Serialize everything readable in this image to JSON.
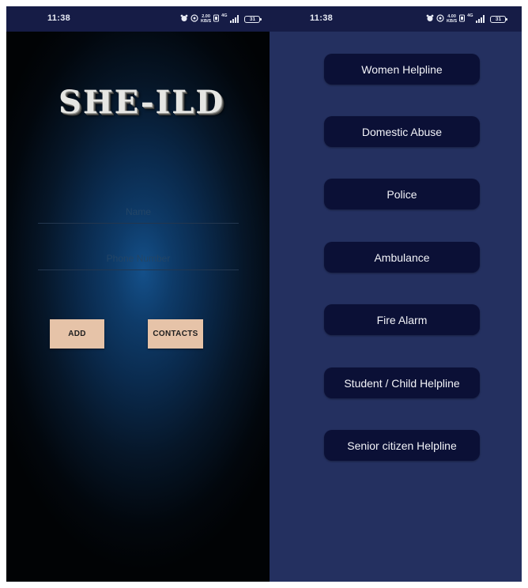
{
  "status_bar_left": {
    "time": "11:38",
    "data_speed_value": "2.00",
    "data_speed_unit": "KB/S",
    "network": "4G",
    "battery": "31"
  },
  "status_bar_right": {
    "time": "11:38",
    "data_speed_value": "4.00",
    "data_speed_unit": "KB/S",
    "network": "4G",
    "battery": "31"
  },
  "register": {
    "title": "SHE-ILD",
    "name_placeholder": "Name",
    "phone_placeholder": "Phone Number",
    "add_label": "ADD",
    "contacts_label": "CONTACTS"
  },
  "helplines": {
    "items": [
      {
        "label": "Women Helpline"
      },
      {
        "label": "Domestic Abuse"
      },
      {
        "label": "Police"
      },
      {
        "label": "Ambulance"
      },
      {
        "label": "Fire Alarm"
      },
      {
        "label": "Student / Child Helpline"
      },
      {
        "label": "Senior citizen Helpline"
      }
    ]
  },
  "colors": {
    "status_bar": "#161c46",
    "left_gradient_center": "#14508a",
    "left_background_edge": "#010305",
    "right_background": "#243060",
    "helpline_button": "#0b1036",
    "action_button": "#e6c3a8",
    "title_text": "#e6e6e3"
  },
  "icons": [
    "alarm-icon",
    "hotspot-icon",
    "volte-icon",
    "signal-icon",
    "battery-icon"
  ]
}
